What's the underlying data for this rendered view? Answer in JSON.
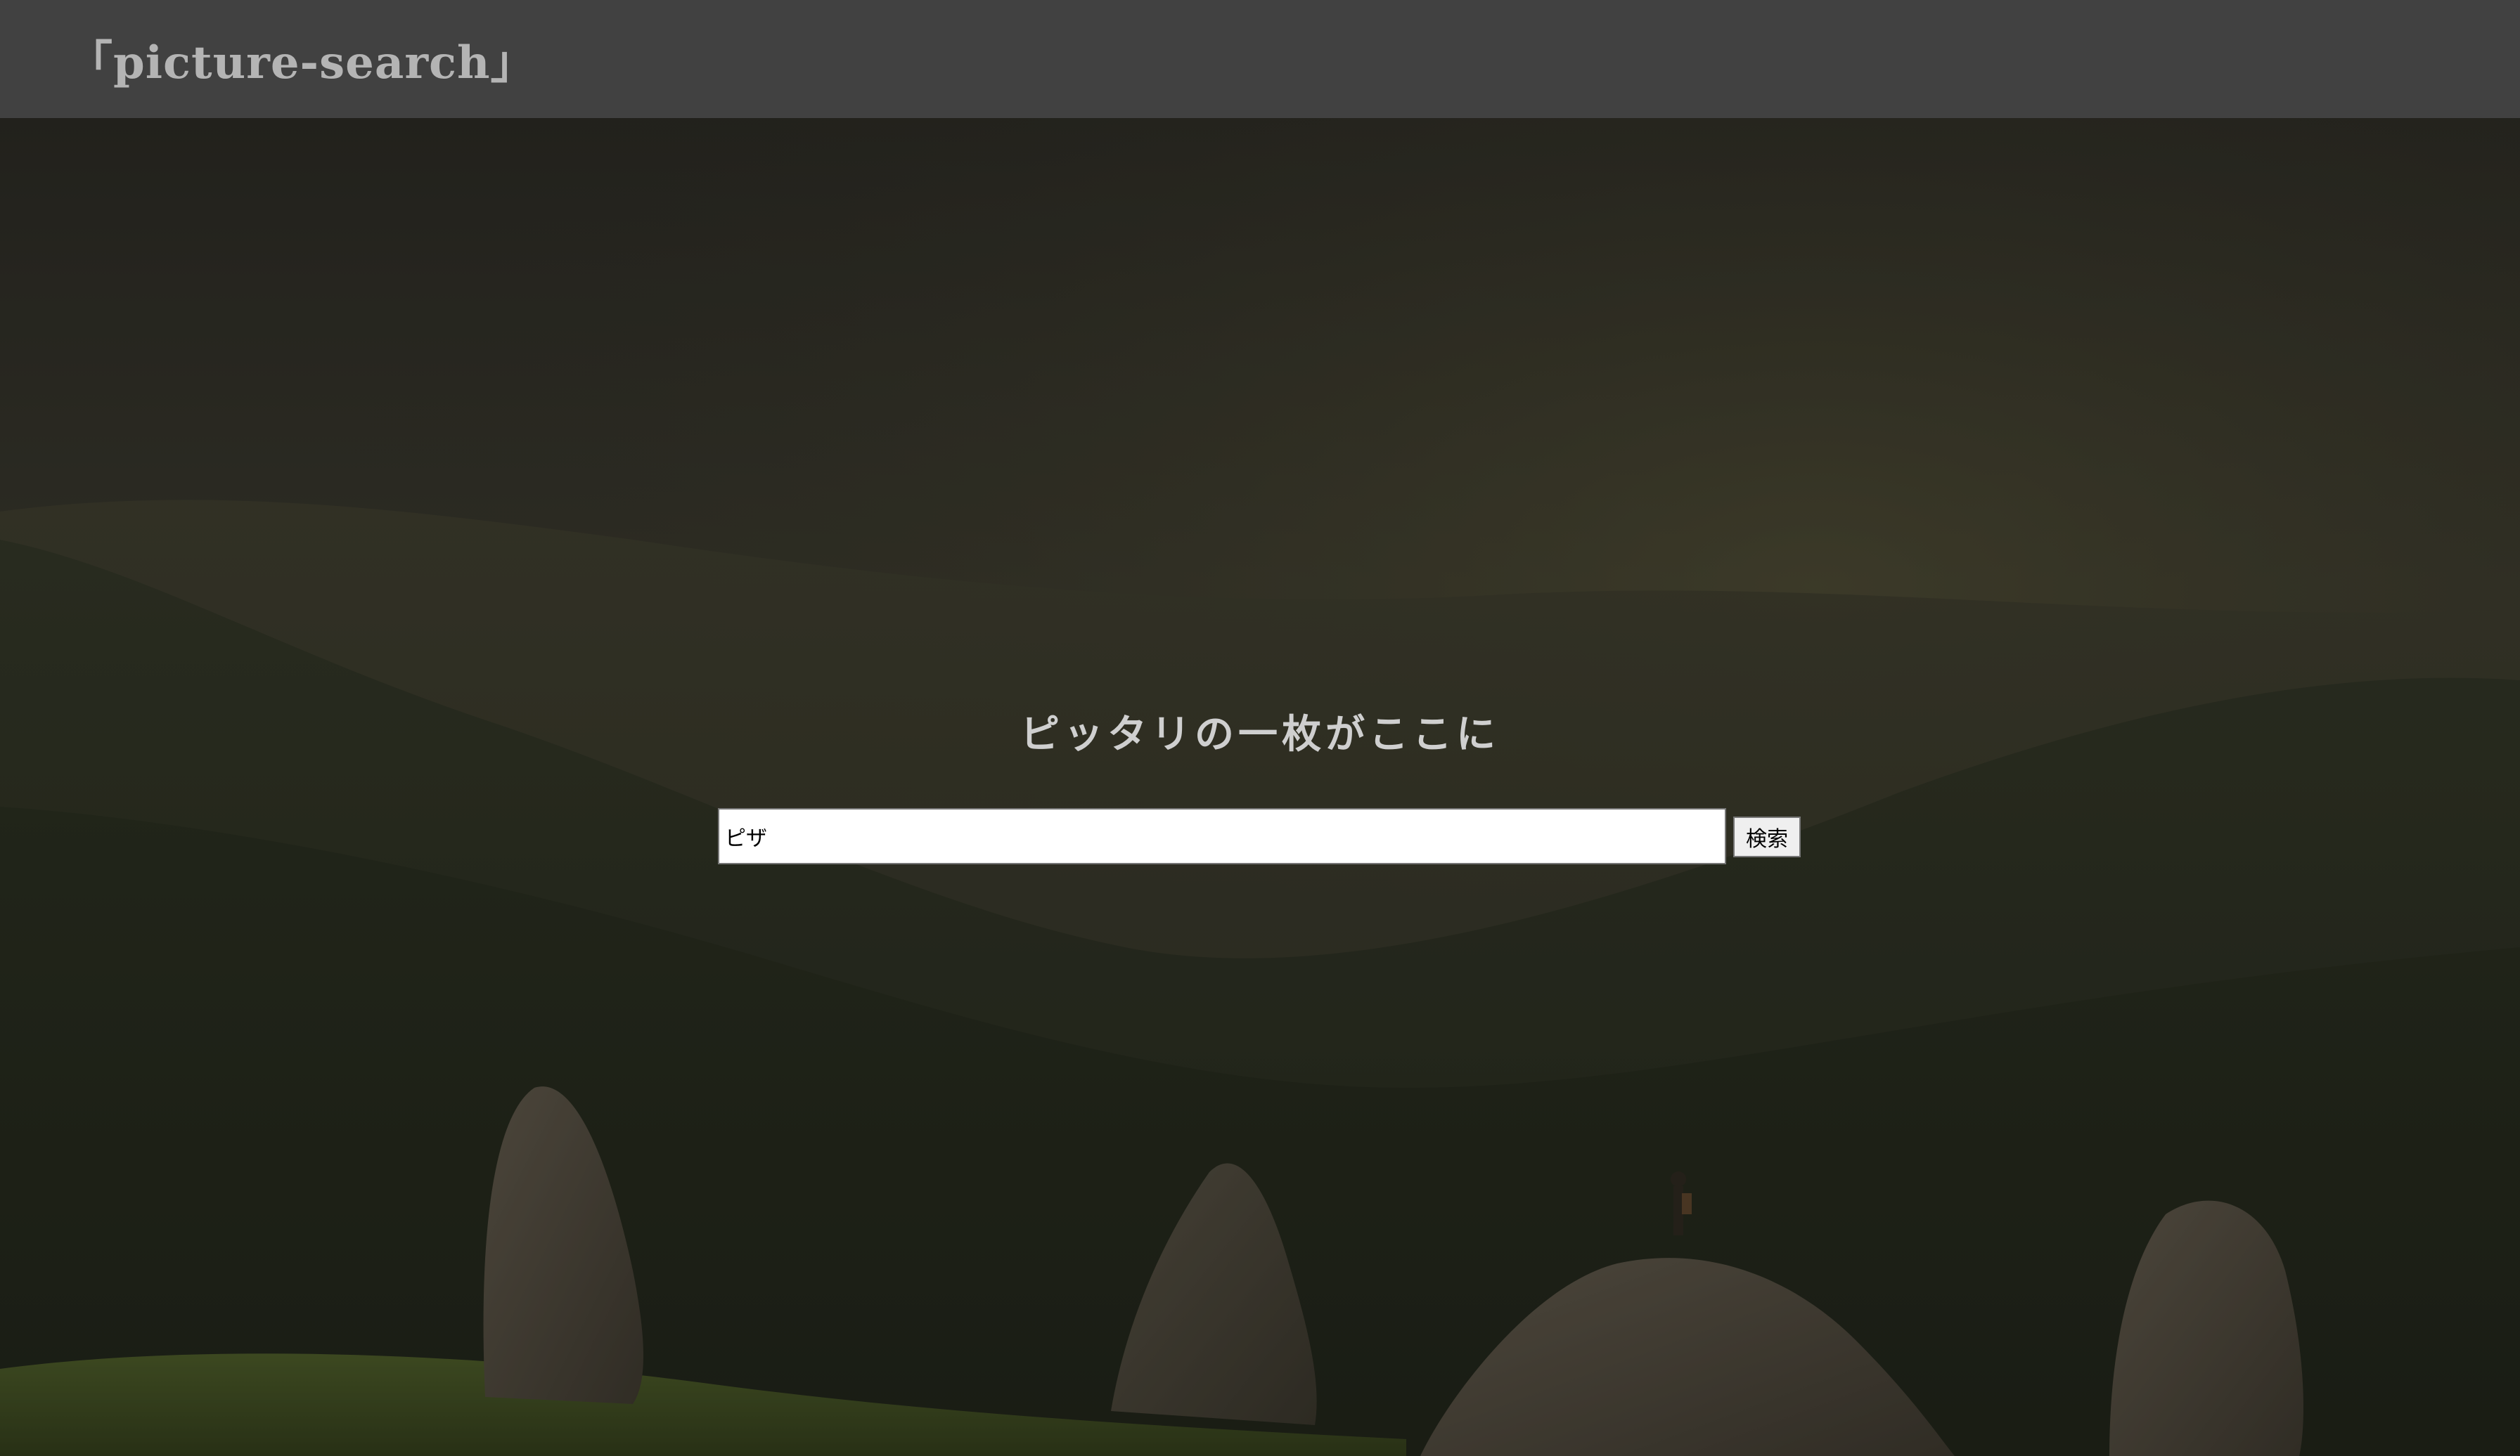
{
  "header": {
    "logo_text": "「picture-search」"
  },
  "hero": {
    "tagline": "ピッタリの一枚がここに",
    "background_image": "mountain-landscape-with-hiker"
  },
  "search": {
    "input_value": "ピザ",
    "button_label": "検索"
  },
  "colors": {
    "header_bg": "#414141",
    "logo_text": "#b4b4b4",
    "tagline_text": "#cfcfcf",
    "input_bg": "#ffffff",
    "button_bg": "#efefef"
  }
}
